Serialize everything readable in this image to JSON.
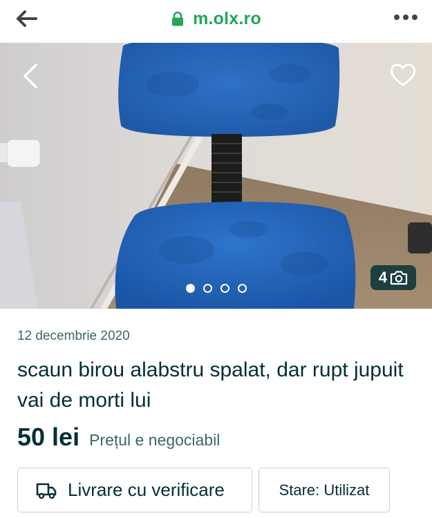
{
  "browser": {
    "url": "m.olx.ro",
    "accent_color": "#23a55a",
    "icons": {
      "back": "arrow-left-icon",
      "lock": "lock-icon",
      "menu": "more-dots-icon"
    }
  },
  "gallery": {
    "photo_count": "4",
    "total_images": 4,
    "active_index": 0,
    "icons": {
      "prev": "chevron-left-icon",
      "favorite": "heart-icon",
      "camera": "camera-icon"
    }
  },
  "listing": {
    "date": "12 decembrie 2020",
    "title": "scaun birou alabstru spalat, dar rupt jupuit vai de morti lui",
    "price": "50 lei",
    "negotiable": "Prețul e negociabil",
    "delivery_label": "Livrare cu verificare",
    "delivery_icon": "truck-icon",
    "state_label": "Stare: Utilizat",
    "text_color": "#002f34"
  }
}
